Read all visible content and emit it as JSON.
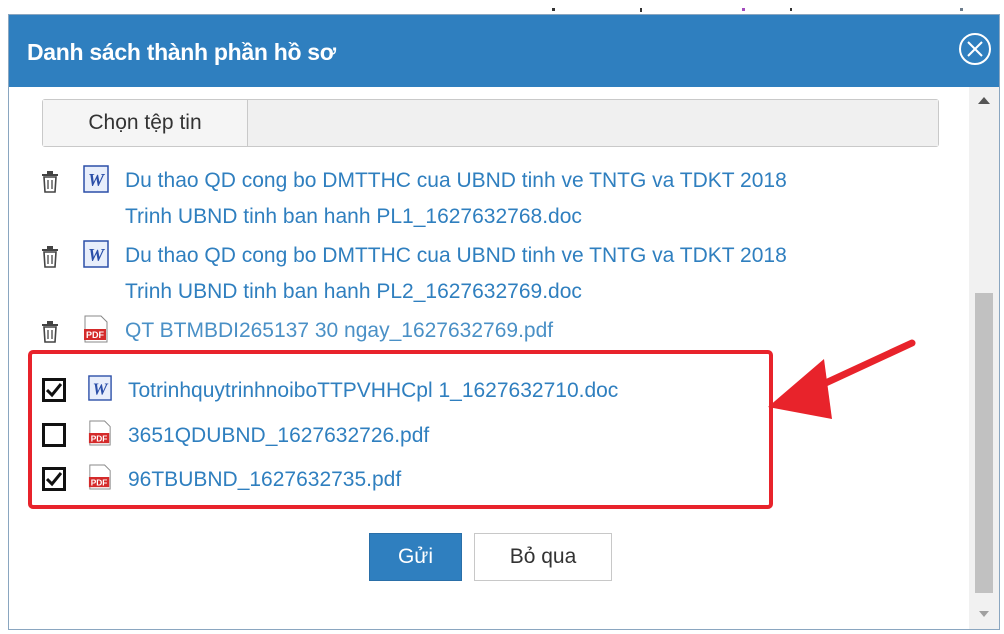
{
  "dialog": {
    "title": "Danh sách thành phần hồ sơ",
    "close_icon": "close-circle-icon"
  },
  "file_picker": {
    "button_label": "Chọn tệp tin",
    "value": ""
  },
  "uploaded_files": [
    {
      "line1": "Du thao QD cong bo DMTTHC cua UBND tinh ve TNTG va TDKT 2018",
      "line2": "Trinh UBND tinh ban hanh PL1_1627632768.doc",
      "type": "word-icon"
    },
    {
      "line1": "Du thao QD cong bo DMTTHC cua UBND tinh ve TNTG va TDKT 2018",
      "line2": "Trinh UBND tinh ban hanh PL2_1627632769.doc",
      "type": "word-icon"
    },
    {
      "line1": "QT BTMBDI265137 30 ngay_1627632769.pdf",
      "line2": "",
      "type": "pdf-icon"
    }
  ],
  "selectable_files": [
    {
      "name": "TotrinhquytrinhnoiboTTPVHHCpl 1_1627632710.doc",
      "checked": true,
      "type": "word-icon"
    },
    {
      "name": "3651QDUBND_1627632726.pdf",
      "checked": false,
      "type": "pdf-icon"
    },
    {
      "name": "96TBUBND_1627632735.pdf",
      "checked": true,
      "type": "pdf-icon"
    }
  ],
  "buttons": {
    "send": "Gửi",
    "skip": "Bỏ qua"
  },
  "colors": {
    "title_bar": "#2f7fbf",
    "link": "#2f7fbf",
    "highlight": "#e8232b"
  }
}
